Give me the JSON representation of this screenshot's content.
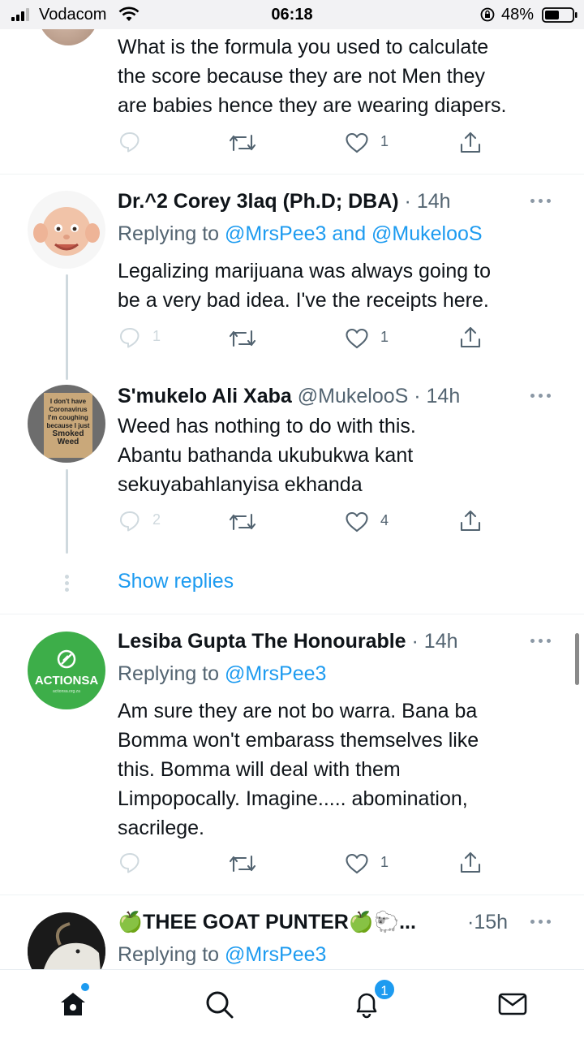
{
  "status_bar": {
    "carrier": "Vodacom",
    "time": "06:18",
    "battery": "48%"
  },
  "tweets": [
    {
      "text_lines": [
        "What is the formula you used to calculate",
        "the score because they are not Men they",
        "are babies hence they are wearing diapers."
      ],
      "reply_count": "",
      "like_count": "1"
    },
    {
      "name": "Dr.^2 Corey 3laq (Ph.D; DBA)",
      "meta": " · 14h",
      "replying_prefix": "Replying to ",
      "replying_mentions": "@MrsPee3 and @MukelooS",
      "text_lines": [
        "Legalizing marijuana was always going to",
        "be a very bad idea. I've the receipts here."
      ],
      "reply_count": "1",
      "like_count": "1"
    },
    {
      "name": "S'mukelo Ali Xaba",
      "meta": " @MukelooS · 14h",
      "avatar_sign_lines": [
        "I don't have",
        "Coronavirus",
        "I'm coughing",
        "because I just",
        "Smoked",
        "Weed"
      ],
      "text_lines": [
        "Weed has nothing to do with this.",
        "Abantu bathanda ukubukwa kant",
        "sekuyabahlanyisa ekhanda"
      ],
      "reply_count": "2",
      "like_count": "4",
      "show_replies": "Show replies"
    },
    {
      "name": "Lesiba Gupta The Honourable",
      "meta": " · 14h",
      "replying_prefix": "Replying to ",
      "replying_mentions": "@MrsPee3",
      "avatar_logo": "ACTIONSA",
      "avatar_logo_sub": "actionsa.org.za",
      "text_lines": [
        "Am sure they are not bo warra. Bana ba",
        "Bomma won't embarass themselves like",
        "this. Bomma will deal with them",
        "Limpopocally. Imagine..... abomination,",
        "sacrilege."
      ],
      "reply_count": "",
      "like_count": "1"
    },
    {
      "name": "🍏THEE GOAT PUNTER🍏🐑...",
      "meta": " ·15h",
      "replying_prefix": "Replying to ",
      "replying_mentions": "@MrsPee3"
    }
  ],
  "bottom_nav": {
    "notifications_badge": "1",
    "items": [
      "home-icon",
      "search-icon",
      "bell-icon",
      "mail-icon"
    ]
  },
  "colors": {
    "accent": "#1d9bf0",
    "text": "#0f1419",
    "secondary": "#536471",
    "actionsa_green": "#3dae49"
  }
}
